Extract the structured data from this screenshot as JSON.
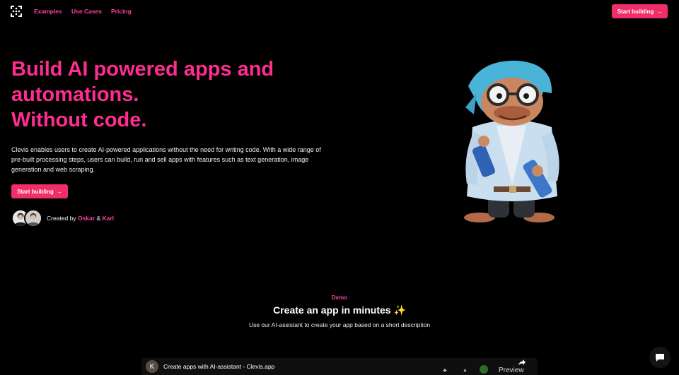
{
  "nav": {
    "links": [
      "Examples",
      "Use Cases",
      "Pricing"
    ],
    "cta": "Start building"
  },
  "hero": {
    "title_lines": [
      "Build AI powered apps and",
      "automations.",
      "Without code."
    ],
    "description": "Clevis enables users to create AI-powered applications without the need for writing code. With a wide range of pre-built processing steps, users can build, run and sell apps with features such as text generation, image generation and web scraping.",
    "cta": "Start building",
    "created_prefix": "Created by",
    "creator_1": "Oskar",
    "ampersand": "&",
    "creator_2": "Karl"
  },
  "demo": {
    "tag": "Demo",
    "title": "Create an app in minutes ✨",
    "subtitle": "Use our AI-assistant to create your app based on a short description"
  },
  "video": {
    "channel_initial": "K",
    "title": "Create apps with AI-assistant - Clevis.app",
    "preview_label": "Preview"
  },
  "colors": {
    "accent": "#ff2d8f",
    "button": "#f02e68",
    "background": "#000000"
  },
  "icons": {
    "logo": "clevis-logo-icon",
    "arrow": "arrow-right-icon",
    "chat": "chat-bubble-icon",
    "share": "share-icon"
  }
}
